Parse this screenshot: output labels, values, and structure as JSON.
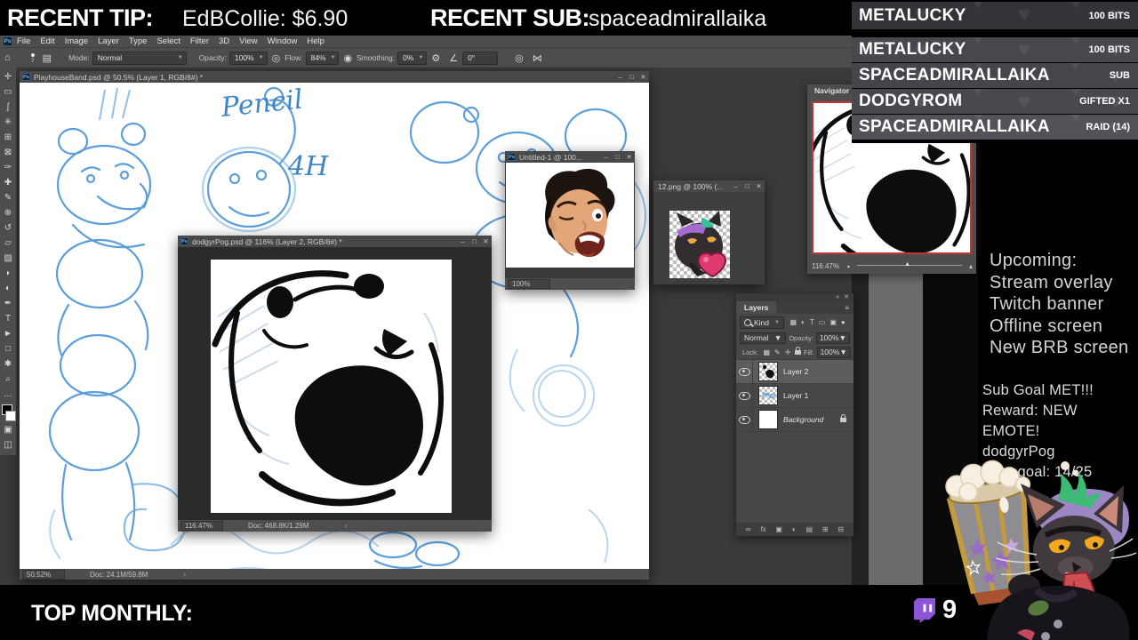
{
  "top_bar": {
    "recent_tip_label": "RECENT TIP:",
    "recent_tip_value": "EdBCollie: $6.90",
    "recent_sub_label": "RECENT SUB:",
    "recent_sub_value": "spaceadmirallaika"
  },
  "notifications": [
    {
      "name": "METALUCKY",
      "detail": "100 BITS"
    },
    {
      "name": "METALUCKY",
      "detail": "100 BITS"
    },
    {
      "name": "SPACEADMIRALLAIKA",
      "detail": "SUB"
    },
    {
      "name": "DODGYROM",
      "detail": "GIFTED X1"
    },
    {
      "name": "SPACEADMIRALLAIKA",
      "detail": "RAID (14)"
    }
  ],
  "photoshop": {
    "ps_icon": "Ps",
    "menu": [
      "File",
      "Edit",
      "Image",
      "Layer",
      "Type",
      "Select",
      "Filter",
      "3D",
      "View",
      "Window",
      "Help"
    ],
    "options": {
      "home_icon": "⌂",
      "brush_size": "7",
      "mode_label": "Mode:",
      "mode_value": "Normal",
      "opacity_label": "Opacity:",
      "opacity_value": "100%",
      "flow_label": "Flow:",
      "flow_value": "84%",
      "smoothing_label": "Smoothing:",
      "smoothing_value": "0%",
      "angle_value": "0°"
    },
    "tools": [
      {
        "name": "move-tool",
        "glyph": "✛"
      },
      {
        "name": "marquee-tool",
        "glyph": "▭"
      },
      {
        "name": "lasso-tool",
        "glyph": "ʃ"
      },
      {
        "name": "quick-selection-tool",
        "glyph": "✳"
      },
      {
        "name": "crop-tool",
        "glyph": "⊞"
      },
      {
        "name": "frame-tool",
        "glyph": "⊠"
      },
      {
        "name": "eyedropper-tool",
        "glyph": "✑"
      },
      {
        "name": "healing-brush-tool",
        "glyph": "✚"
      },
      {
        "name": "brush-tool",
        "glyph": "✎"
      },
      {
        "name": "clone-stamp-tool",
        "glyph": "⊕"
      },
      {
        "name": "history-brush-tool",
        "glyph": "↺"
      },
      {
        "name": "eraser-tool",
        "glyph": "▱"
      },
      {
        "name": "gradient-tool",
        "glyph": "▨"
      },
      {
        "name": "smudge-tool",
        "glyph": "◗"
      },
      {
        "name": "dodge-tool",
        "glyph": "◐"
      },
      {
        "name": "pen-tool",
        "glyph": "✒"
      },
      {
        "name": "type-tool",
        "glyph": "T"
      },
      {
        "name": "path-select-tool",
        "glyph": "►"
      },
      {
        "name": "shape-tool",
        "glyph": "□"
      },
      {
        "name": "hand-tool",
        "glyph": "✱"
      },
      {
        "name": "zoom-tool",
        "glyph": "⌕"
      },
      {
        "name": "more-tools",
        "glyph": "…"
      }
    ],
    "window_controls": {
      "minimize": "–",
      "maximize": "□",
      "close": "✕"
    },
    "status_chevron": "›",
    "windows": {
      "main": {
        "title": "PlayhouseBand.psd @ 50.5% (Layer 1, RGB/8#) *",
        "zoom": "50.52%",
        "doc": "Doc: 24.1M/59.8M",
        "annotation_line1": "Pencil",
        "annotation_line2": "4H"
      },
      "untitled": {
        "title": "Untitled-1 @ 100...",
        "zoom": "100%"
      },
      "png12": {
        "title": "12.png @ 100% (..."
      },
      "dodgyr": {
        "title": "dodgyrPog.psd @ 116% (Layer 2, RGB/8#) *",
        "zoom": "116.47%",
        "doc": "Doc: 468.8K/1.29M"
      }
    },
    "navigator": {
      "tab": "Navigator",
      "zoom": "116.47%"
    },
    "layers_panel": {
      "tab": "Layers",
      "kind_label": "Kind",
      "blend_mode": "Normal",
      "opacity_label": "Opacity:",
      "opacity_value": "100%",
      "lock_label": "Lock:",
      "fill_label": "Fill:",
      "fill_value": "100%",
      "fx_label": "fx",
      "layers": [
        {
          "name": "Layer 2"
        },
        {
          "name": "Layer 1"
        },
        {
          "name": "Background"
        }
      ]
    }
  },
  "stream_panel": {
    "upcoming": [
      "Upcoming:",
      "Stream overlay",
      "Twitch banner",
      "Offline screen",
      "New BRB screen"
    ],
    "goals": [
      "Sub Goal MET!!!",
      "Reward: NEW EMOTE!",
      "dodgyrPog",
      "Next goal: 14/25"
    ]
  },
  "bottom_bar": {
    "label": "TOP MONTHLY:",
    "twitch_count": "9"
  }
}
